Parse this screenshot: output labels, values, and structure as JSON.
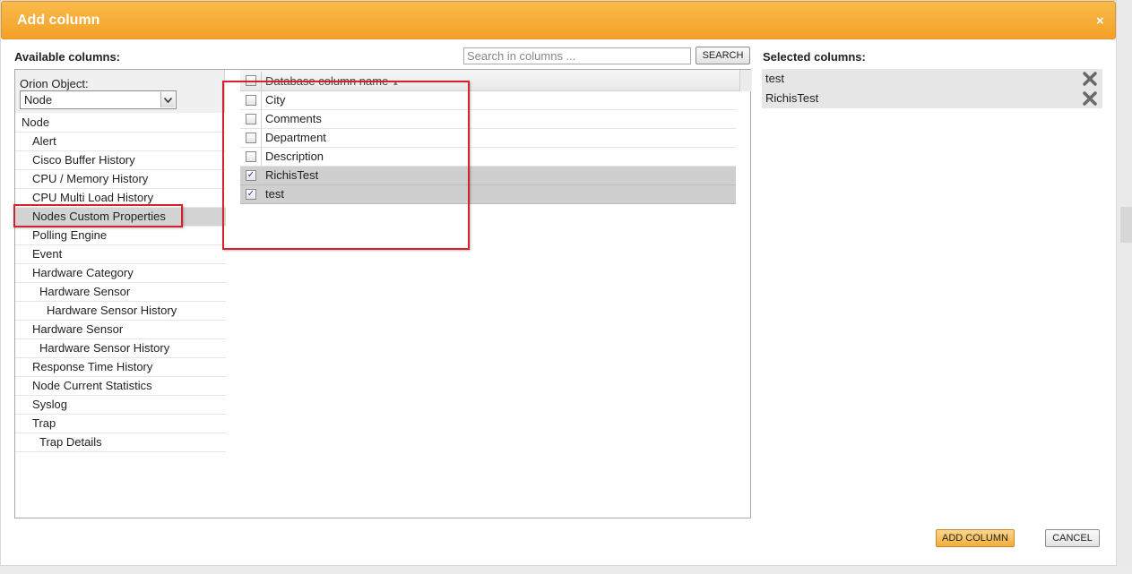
{
  "dialog": {
    "title": "Add column",
    "close_glyph": "×"
  },
  "available": {
    "label": "Available columns:",
    "search": {
      "placeholder": "Search in columns ...",
      "value": ""
    },
    "search_button": "SEARCH",
    "orion_object": {
      "label": "Orion Object:",
      "selected": "Node"
    },
    "tree": [
      {
        "label": "Node",
        "level": 0,
        "selected": false
      },
      {
        "label": "Alert",
        "level": 1,
        "selected": false
      },
      {
        "label": "Cisco Buffer History",
        "level": 1,
        "selected": false
      },
      {
        "label": "CPU / Memory History",
        "level": 1,
        "selected": false
      },
      {
        "label": "CPU Multi Load History",
        "level": 1,
        "selected": false
      },
      {
        "label": "Nodes Custom Properties",
        "level": 1,
        "selected": true
      },
      {
        "label": "Polling Engine",
        "level": 1,
        "selected": false
      },
      {
        "label": "Event",
        "level": 1,
        "selected": false
      },
      {
        "label": "Hardware Category",
        "level": 1,
        "selected": false
      },
      {
        "label": "Hardware Sensor",
        "level": 2,
        "selected": false
      },
      {
        "label": "Hardware Sensor History",
        "level": 3,
        "selected": false
      },
      {
        "label": "Hardware Sensor",
        "level": 1,
        "selected": false
      },
      {
        "label": "Hardware Sensor History",
        "level": 2,
        "selected": false
      },
      {
        "label": "Response Time History",
        "level": 1,
        "selected": false
      },
      {
        "label": "Node Current Statistics",
        "level": 1,
        "selected": false
      },
      {
        "label": "Syslog",
        "level": 1,
        "selected": false
      },
      {
        "label": "Trap",
        "level": 1,
        "selected": false
      },
      {
        "label": "Trap Details",
        "level": 2,
        "selected": false
      }
    ],
    "grid": {
      "header": "Database column name",
      "sort_glyph": "▲",
      "rows": [
        {
          "label": "City",
          "checked": false
        },
        {
          "label": "Comments",
          "checked": false
        },
        {
          "label": "Department",
          "checked": false
        },
        {
          "label": "Description",
          "checked": false
        },
        {
          "label": "RichisTest",
          "checked": true
        },
        {
          "label": "test",
          "checked": true
        }
      ]
    }
  },
  "selected": {
    "label": "Selected columns:",
    "items": [
      "test",
      "RichisTest"
    ],
    "remove_icon": "close-x-icon"
  },
  "buttons": {
    "add_column": "ADD COLUMN",
    "cancel": "CANCEL"
  },
  "colors": {
    "titlebar": "#f5a72f",
    "callout": "#d4212b",
    "selected_row": "#d3d3d3",
    "checkmark": "#2a3f8a"
  }
}
